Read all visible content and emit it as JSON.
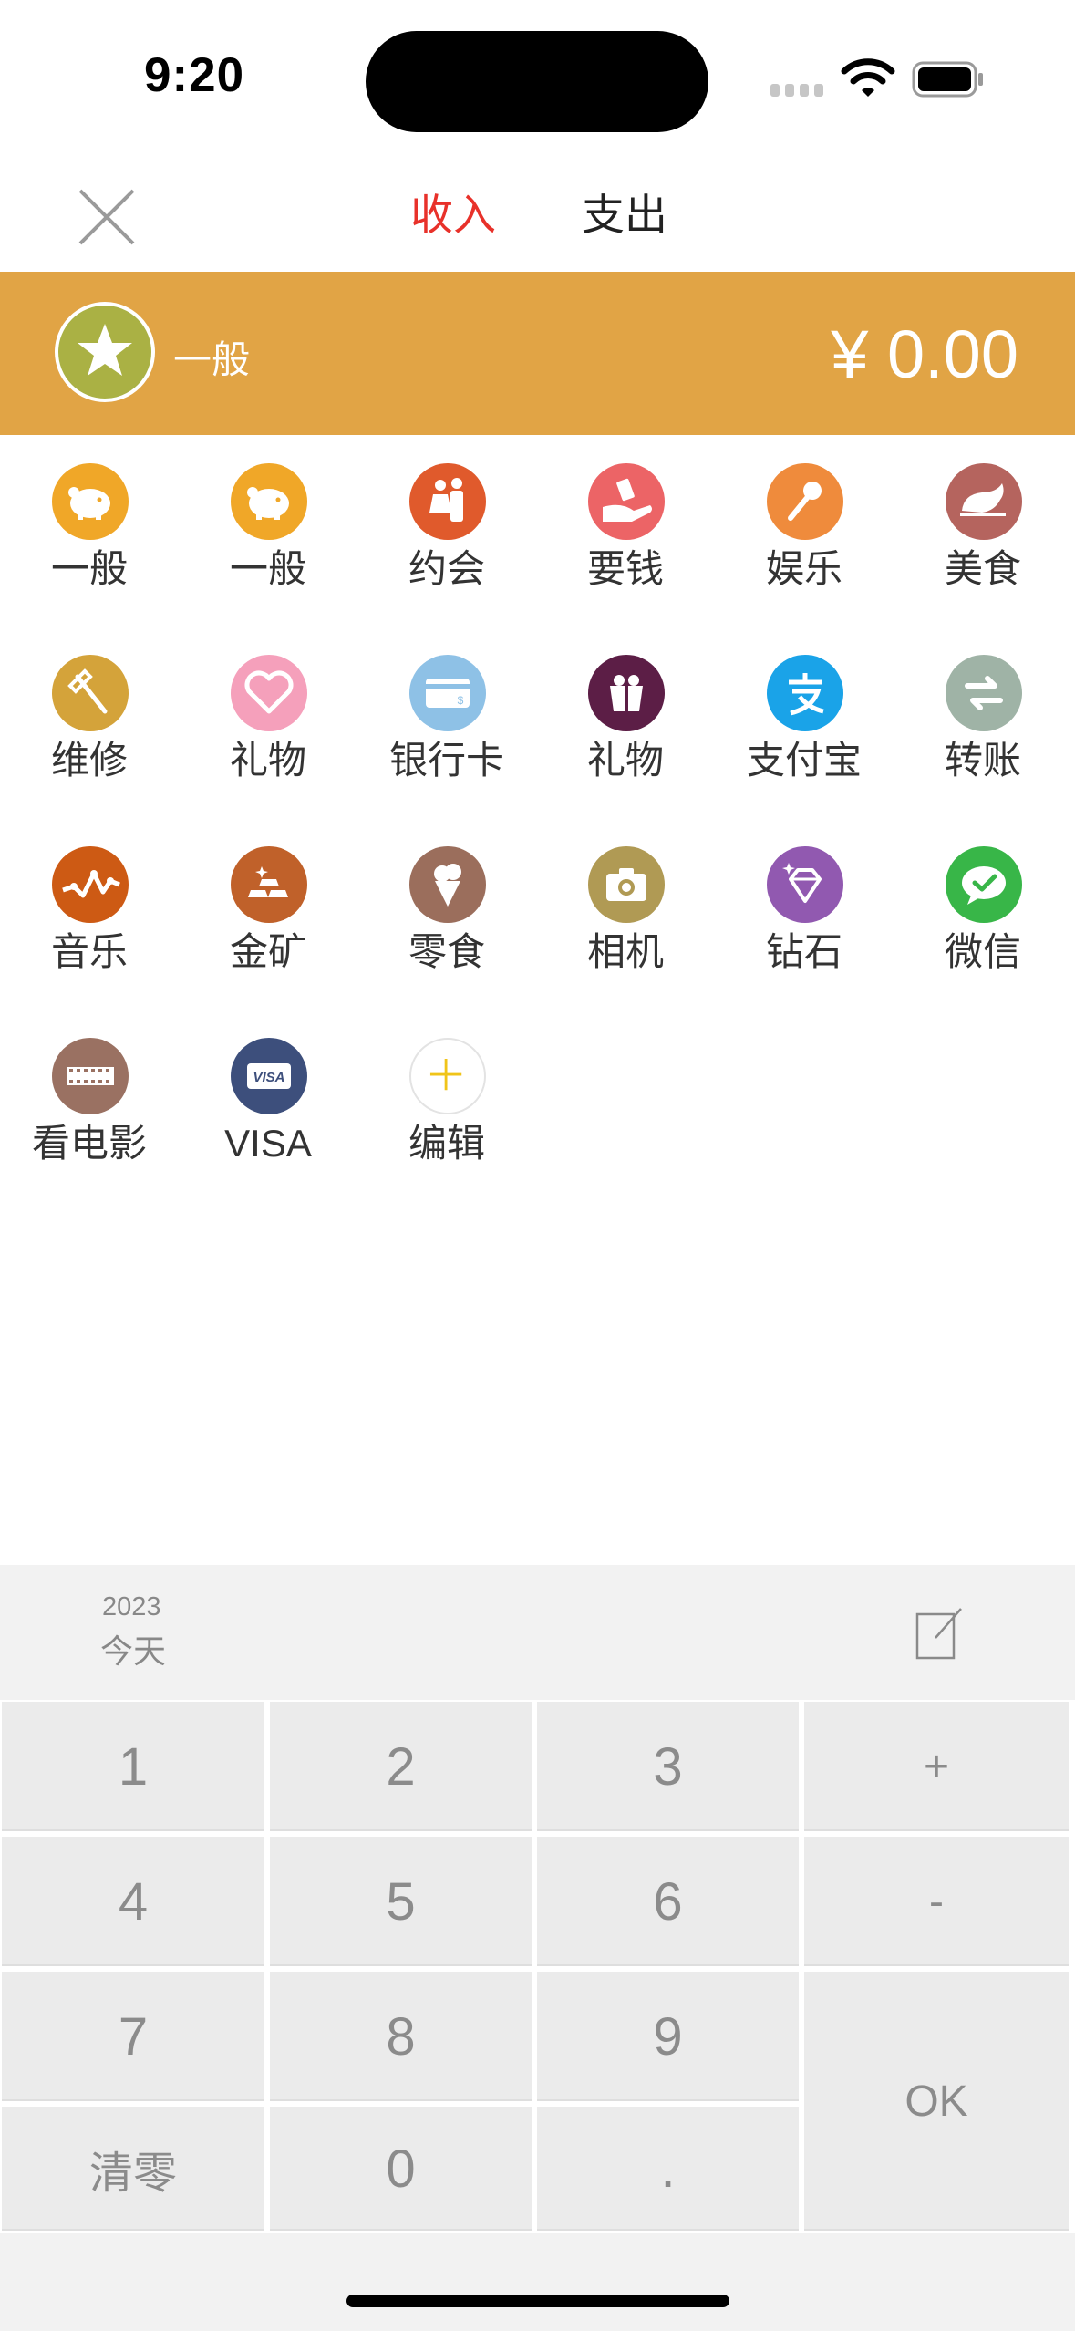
{
  "status_bar": {
    "time": "9:20"
  },
  "header": {
    "close_icon": "close-x-icon",
    "tabs": [
      {
        "label": "收入",
        "active": true,
        "color": "#e8312a"
      },
      {
        "label": "支出",
        "active": false
      }
    ]
  },
  "banner": {
    "category_icon": "star-icon",
    "category_label": "一般",
    "amount": "¥ 0.00",
    "background": "#e1a445"
  },
  "categories": [
    {
      "label": "一般",
      "icon": "piggy-bank-icon",
      "color": "#f0a728"
    },
    {
      "label": "一般",
      "icon": "piggy-bank-icon",
      "color": "#f0a728"
    },
    {
      "label": "约会",
      "icon": "couple-icon",
      "color": "#e05a2c"
    },
    {
      "label": "要钱",
      "icon": "money-hand-icon",
      "color": "#ec6466"
    },
    {
      "label": "娱乐",
      "icon": "microphone-icon",
      "color": "#ef8b3c"
    },
    {
      "label": "美食",
      "icon": "roast-chicken-icon",
      "color": "#b5645e"
    },
    {
      "label": "维修",
      "icon": "hammer-icon",
      "color": "#d4a33a"
    },
    {
      "label": "礼物",
      "icon": "heart-icon",
      "color": "#f5a0bb"
    },
    {
      "label": "银行卡",
      "icon": "bank-card-icon",
      "color": "#8ec1e6"
    },
    {
      "label": "礼物",
      "icon": "gift-box-icon",
      "color": "#5c1e46"
    },
    {
      "label": "支付宝",
      "icon": "alipay-icon",
      "color": "#1aa3e8"
    },
    {
      "label": "转账",
      "icon": "transfer-icon",
      "color": "#9fb3a6"
    },
    {
      "label": "音乐",
      "icon": "music-wave-icon",
      "color": "#cd5a14"
    },
    {
      "label": "金矿",
      "icon": "gold-bars-icon",
      "color": "#c0612a"
    },
    {
      "label": "零食",
      "icon": "ice-cream-icon",
      "color": "#9b6e5c"
    },
    {
      "label": "相机",
      "icon": "camera-icon",
      "color": "#b09a54"
    },
    {
      "label": "钻石",
      "icon": "diamond-icon",
      "color": "#9159b0"
    },
    {
      "label": "微信",
      "icon": "wechat-icon",
      "color": "#38b648"
    },
    {
      "label": "看电影",
      "icon": "film-strip-icon",
      "color": "#9a7162"
    },
    {
      "label": "VISA",
      "icon": "visa-card-icon",
      "color": "#3d4f7c"
    },
    {
      "label": "编辑",
      "icon": "add-plus-icon",
      "color": "#f0c419"
    }
  ],
  "datebar": {
    "year": "2023",
    "day": "今天",
    "note_icon": "note-edit-icon"
  },
  "keypad": {
    "keys": [
      "1",
      "2",
      "3",
      "+",
      "4",
      "5",
      "6",
      "-",
      "7",
      "8",
      "9",
      "OK",
      "清零",
      "0",
      "."
    ]
  }
}
